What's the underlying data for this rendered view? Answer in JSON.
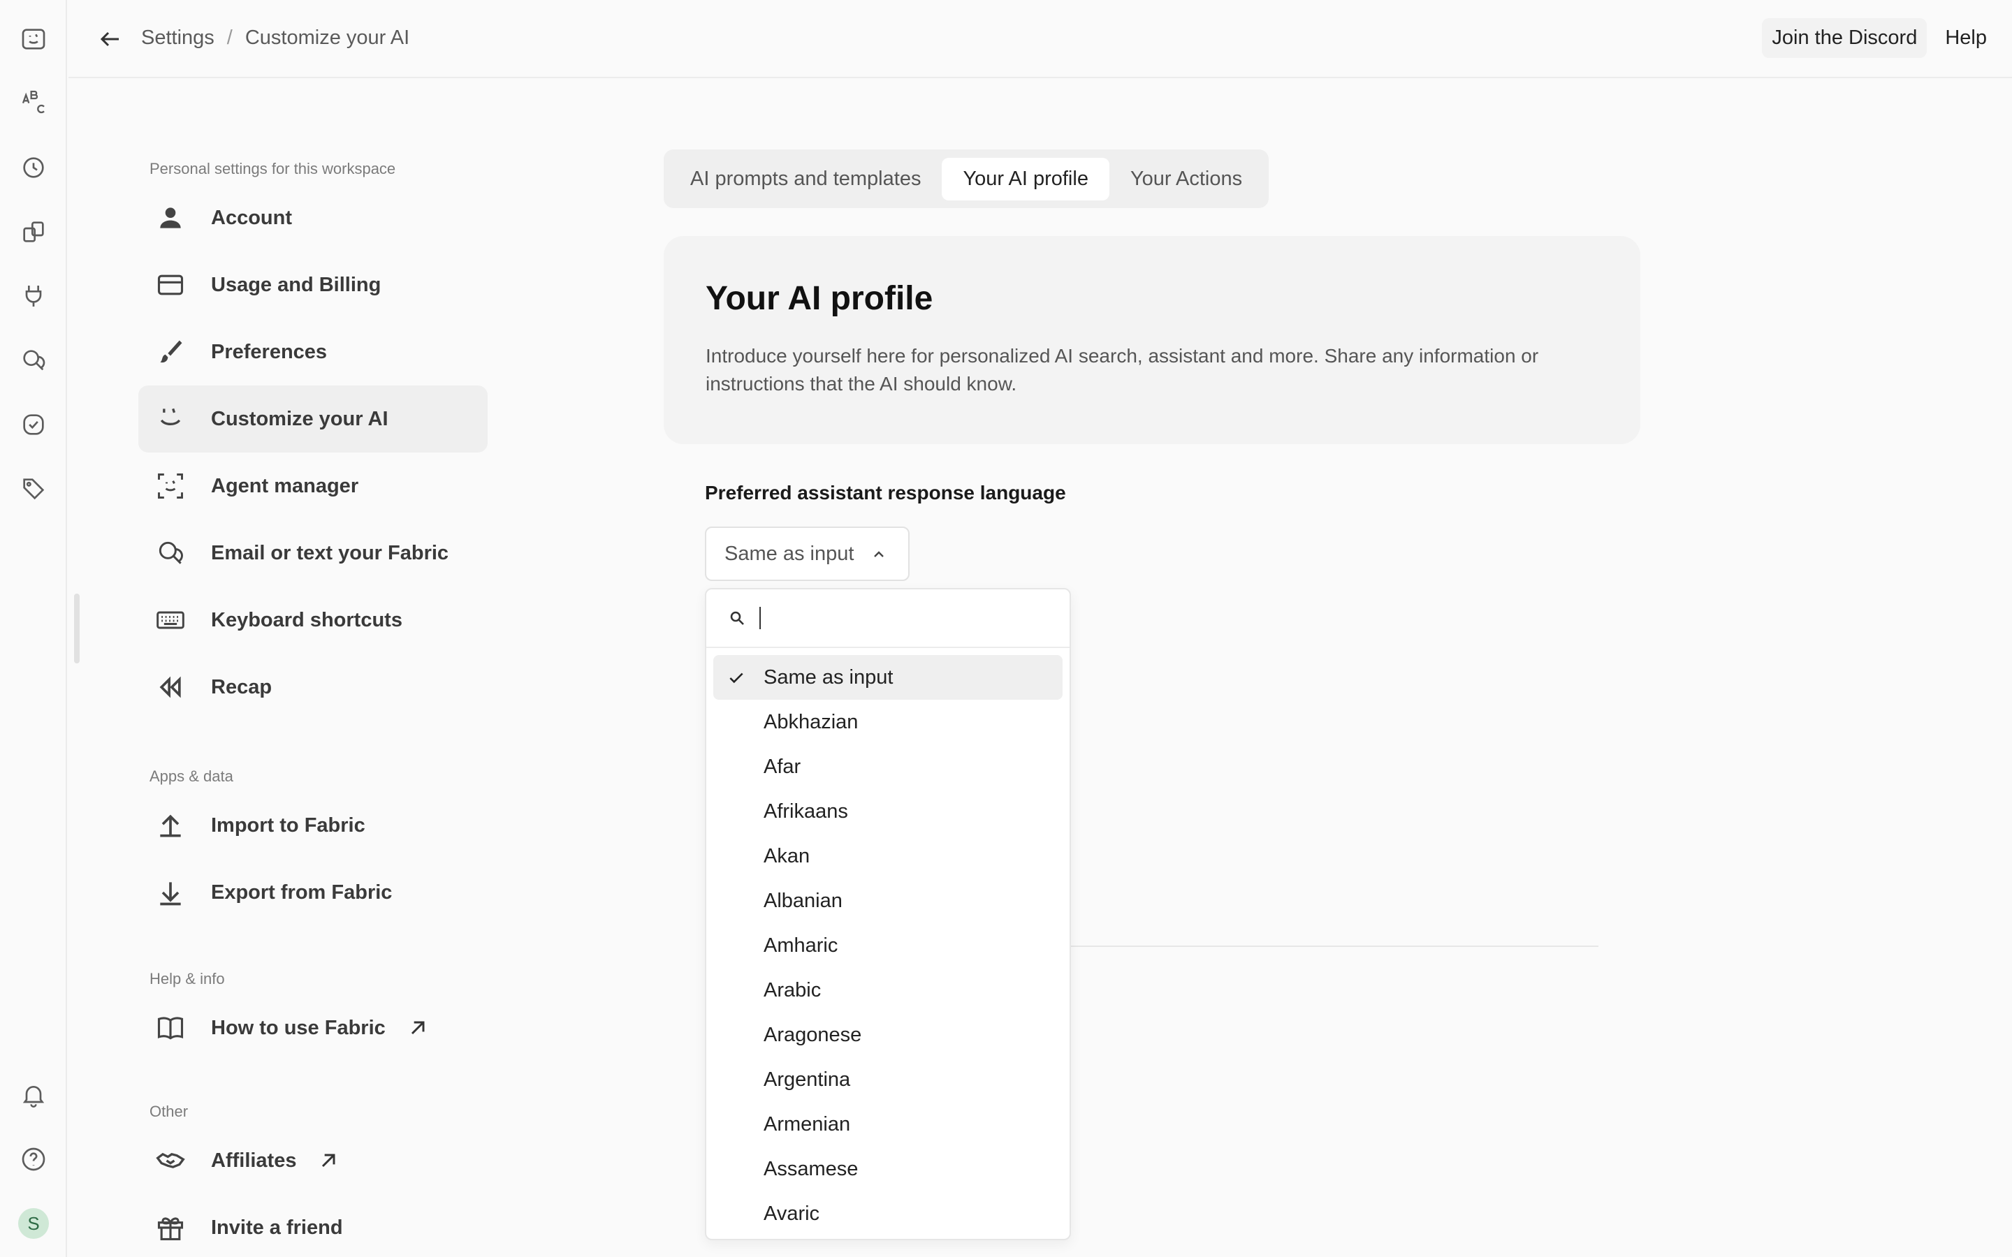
{
  "topbar": {
    "breadcrumb": [
      "Settings",
      "Customize your AI"
    ],
    "links": [
      "Join the Discord",
      "Help"
    ]
  },
  "rail": {
    "icons": [
      "fabric-face-icon",
      "spellcheck-icon",
      "history-icon",
      "spaces-icon",
      "plug-icon",
      "chat-icon",
      "check-circle-icon",
      "tag-icon",
      "bell-icon",
      "help-icon"
    ],
    "avatar_initial": "S"
  },
  "nav": {
    "sections": [
      {
        "title": "Personal settings for this workspace",
        "items": [
          {
            "label": "Account",
            "icon": "person-icon"
          },
          {
            "label": "Usage and Billing",
            "icon": "credit-card-icon"
          },
          {
            "label": "Preferences",
            "icon": "brush-icon"
          },
          {
            "label": "Customize your AI",
            "icon": "ai-face-icon",
            "active": true
          },
          {
            "label": "Agent manager",
            "icon": "agent-frame-icon"
          },
          {
            "label": "Email or text your Fabric",
            "icon": "chat-bubbles-icon"
          },
          {
            "label": "Keyboard shortcuts",
            "icon": "keyboard-icon"
          },
          {
            "label": "Recap",
            "icon": "rewind-icon"
          }
        ]
      },
      {
        "title": "Apps & data",
        "items": [
          {
            "label": "Import to Fabric",
            "icon": "upload-icon"
          },
          {
            "label": "Export from Fabric",
            "icon": "download-icon"
          }
        ]
      },
      {
        "title": "Help & info",
        "items": [
          {
            "label": "How to use Fabric",
            "icon": "book-icon",
            "external": true
          }
        ]
      },
      {
        "title": "Other",
        "items": [
          {
            "label": "Affiliates",
            "icon": "handshake-icon",
            "external": true
          },
          {
            "label": "Invite a friend",
            "icon": "gift-icon"
          }
        ]
      }
    ]
  },
  "tabs": [
    {
      "label": "AI prompts and templates"
    },
    {
      "label": "Your AI profile",
      "active": true
    },
    {
      "label": "Your Actions"
    }
  ],
  "profile": {
    "title": "Your AI profile",
    "description": "Introduce yourself here for personalized AI search, assistant and more. Share any information or instructions that the AI should know."
  },
  "language": {
    "label": "Preferred assistant response language",
    "selected": "Same as input",
    "search_placeholder": "",
    "options": [
      "Same as input",
      "Abkhazian",
      "Afar",
      "Afrikaans",
      "Akan",
      "Albanian",
      "Amharic",
      "Arabic",
      "Aragonese",
      "Argentina",
      "Armenian",
      "Assamese",
      "Avaric"
    ]
  }
}
